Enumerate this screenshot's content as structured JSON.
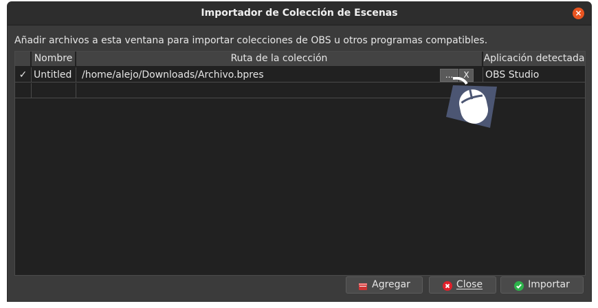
{
  "window": {
    "title": "Importador de Colección de Escenas",
    "close_glyph": "×"
  },
  "description": "Añadir archivos a esta ventana para importar colecciones de OBS u otros programas compatibles.",
  "table": {
    "headers": [
      "",
      "Nombre",
      "Ruta de la colección",
      "Aplicación detectada"
    ],
    "rows": [
      {
        "check": "✓",
        "name": "Untitled",
        "path": "/home/alejo/Downloads/Archivo.bpres",
        "browse_label": "...",
        "remove_label": "X",
        "app": "OBS Studio"
      }
    ]
  },
  "buttons": {
    "add": "Agregar",
    "close": "Close",
    "import": "Importar"
  },
  "colors": {
    "accent_close": "#e95420",
    "import_icon": "#2db34a",
    "close_icon": "#e0202b"
  },
  "icons": {
    "cursor": "mouse-click-icon",
    "add": "folder-add-icon",
    "close": "close-circle-icon",
    "import": "check-circle-icon"
  }
}
